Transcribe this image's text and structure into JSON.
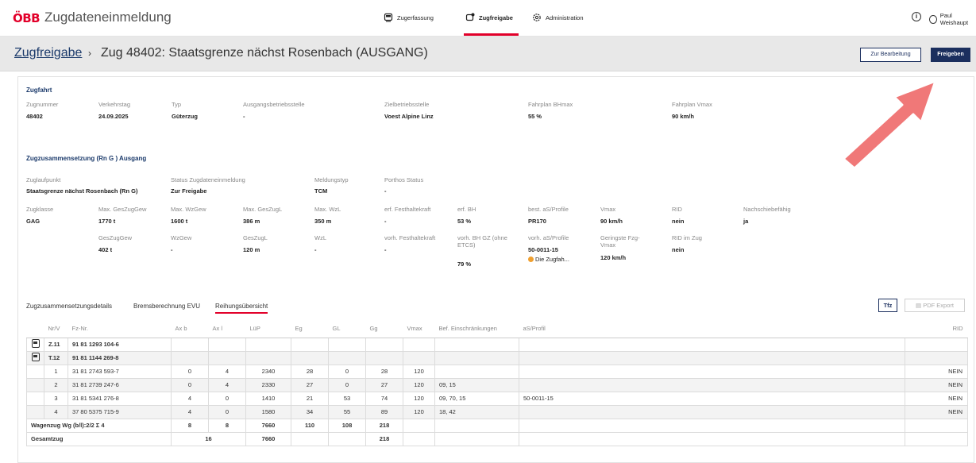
{
  "app": {
    "logo": "ÖBB",
    "title": "Zugdateneinmeldung"
  },
  "nav": [
    {
      "label": "Zugerfassung",
      "icon": "train-icon"
    },
    {
      "label": "Zugfreigabe",
      "icon": "train-release-icon",
      "active": true
    },
    {
      "label": "Administration",
      "icon": "gear-icon"
    }
  ],
  "user": {
    "name": "Paul Weishaupt",
    "info_icon": "info-icon"
  },
  "header": {
    "breadcrumb_link": "Zugfreigabe",
    "separator": "›",
    "title": "Zug 48402: Staatsgrenze nächst Rosenbach (AUSGANG)",
    "btn_edit": "Zur Bearbeitung",
    "btn_release": "Freigeben"
  },
  "zugfahrt": {
    "title": "Zugfahrt",
    "fields": [
      {
        "label": "Zugnummer",
        "value": "48402"
      },
      {
        "label": "Verkehrstag",
        "value": "24.09.2025"
      },
      {
        "label": "Typ",
        "value": "Güterzug"
      },
      {
        "label": "Ausgangsbetriebsstelle",
        "value": "-"
      },
      {
        "label": "Zielbetriebsstelle",
        "value": "Voest Alpine Linz"
      },
      {
        "label": "Fahrplan BHmax",
        "value": "55 %"
      },
      {
        "label": "Fahrplan Vmax",
        "value": "90 km/h"
      }
    ]
  },
  "zusammensetzung": {
    "title": "Zugzusammensetzung (Rn G ) Ausgang",
    "row1": [
      {
        "label": "Zuglaufpunkt",
        "value": "Staatsgrenze nächst Rosenbach (Rn G)"
      },
      {
        "label": "Status Zugdateneinmeldung",
        "value": "Zur Freigabe"
      },
      {
        "label": "Meldungstyp",
        "value": "TCM"
      },
      {
        "label": "Porthos Status",
        "value": "-"
      }
    ],
    "row2": [
      {
        "label": "Zugklasse",
        "value": "GAG"
      },
      {
        "label": "Max. GesZugGew",
        "value": "1770 t"
      },
      {
        "label": "Max. WzGew",
        "value": "1600 t"
      },
      {
        "label": "Max. GesZugL",
        "value": "386 m"
      },
      {
        "label": "Max. WzL",
        "value": "350 m"
      },
      {
        "label": "erf. Festhaltekraft",
        "value": "-"
      },
      {
        "label": "erf. BH",
        "value": "53 %"
      },
      {
        "label": "best. aS/Profile",
        "value": "PR170"
      },
      {
        "label": "Vmax",
        "value": "90 km/h"
      },
      {
        "label": "RID",
        "value": "nein"
      },
      {
        "label": "Nachschiebefähig",
        "value": "ja"
      }
    ],
    "row3": [
      {
        "label": "GesZugGew",
        "value": "402 t"
      },
      {
        "label": "WzGew",
        "value": "-"
      },
      {
        "label": "GesZugL",
        "value": "120 m"
      },
      {
        "label": "WzL",
        "value": "-"
      },
      {
        "label": "vorh. Festhaltekraft",
        "value": "-"
      },
      {
        "label": "vorh. BH GZ (ohne ETCS)",
        "value": "79 %"
      },
      {
        "label": "vorh. aS/Profile",
        "value": "50-0011-15",
        "warning": "Die Zugfah..."
      },
      {
        "label": "Geringste Fzg-Vmax",
        "value": "120 km/h"
      },
      {
        "label": "RID im Zug",
        "value": "nein"
      }
    ]
  },
  "tabs": [
    "Zugzusammensetzungsdetails",
    "Bremsberechnung EVU",
    "Reihungsübersicht"
  ],
  "tab_buttons": {
    "tfz": "Tfz",
    "pdf": "PDF Export"
  },
  "table": {
    "columns": [
      "Nr/V",
      "Fz-Nr.",
      "Ax b",
      "Ax l",
      "LüP",
      "Eg",
      "GL",
      "Gg",
      "Vmax",
      "Bef. Einschränkungen",
      "aS/Profil",
      "RID"
    ],
    "locos": [
      {
        "nr": "Z.11",
        "fz": "91 81 1293 104-6"
      },
      {
        "nr": "T.12",
        "fz": "91 81 1144 269-8"
      }
    ],
    "wagons": [
      {
        "nr": "1",
        "fz": "31 81 2743 593-7",
        "axb": "0",
        "axl": "4",
        "lup": "2340",
        "eg": "28",
        "gl": "0",
        "gg": "28",
        "vmax": "120",
        "bef": "",
        "as": "",
        "rid": "NEIN"
      },
      {
        "nr": "2",
        "fz": "31 81 2739 247-6",
        "axb": "0",
        "axl": "4",
        "lup": "2330",
        "eg": "27",
        "gl": "0",
        "gg": "27",
        "vmax": "120",
        "bef": "09, 15",
        "as": "",
        "rid": "NEIN"
      },
      {
        "nr": "3",
        "fz": "31 81 5341 276-8",
        "axb": "4",
        "axl": "0",
        "lup": "1410",
        "eg": "21",
        "gl": "53",
        "gg": "74",
        "vmax": "120",
        "bef": "09, 70, 15",
        "as": "50-0011-15",
        "rid": "NEIN"
      },
      {
        "nr": "4",
        "fz": "37 80 5375 715-9",
        "axb": "4",
        "axl": "0",
        "lup": "1580",
        "eg": "34",
        "gl": "55",
        "gg": "89",
        "vmax": "120",
        "bef": "18, 42",
        "as": "",
        "rid": "NEIN"
      }
    ],
    "sum_wagons": {
      "label": "Wagenzug Wg (b/l):2/2 Σ 4",
      "axb": "8",
      "axl": "8",
      "lup": "7660",
      "eg": "110",
      "gl": "108",
      "gg": "218"
    },
    "sum_total": {
      "label": "Gesamtzug",
      "ax": "16",
      "lup": "7660",
      "gg": "218"
    }
  },
  "colors": {
    "brand_red": "#e2002a",
    "navy": "#1b2f5e",
    "arrow": "#f07878"
  }
}
